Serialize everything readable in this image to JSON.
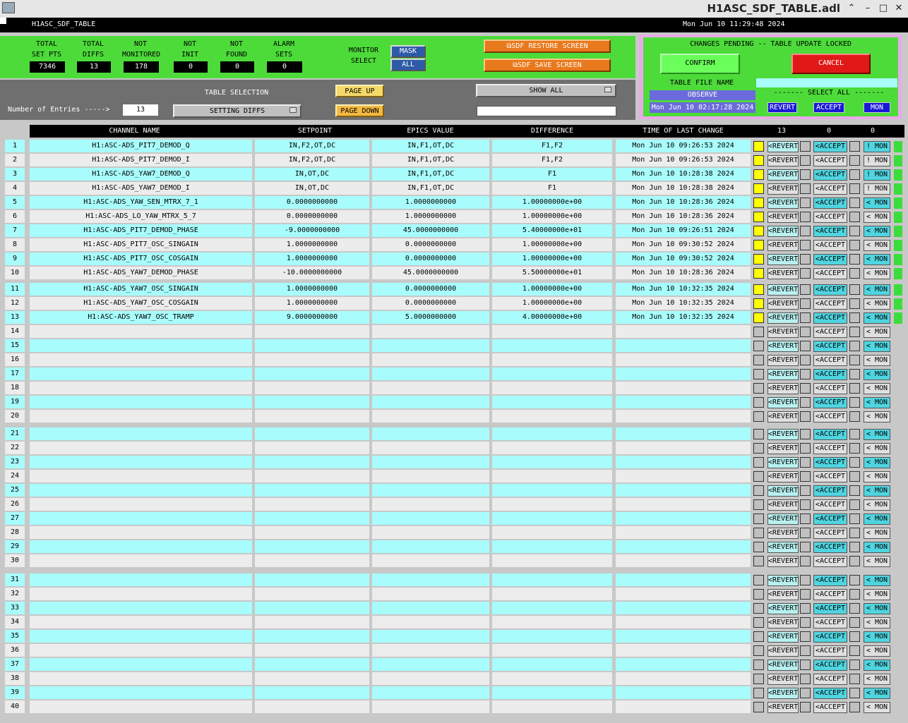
{
  "window": {
    "title": "H1ASC_SDF_TABLE.adl"
  },
  "header": {
    "left": "H1ASC_SDF_TABLE",
    "date": "Mon Jun 10 11:29:48 2024"
  },
  "stats": [
    {
      "label": "TOTAL\nSET PTS",
      "value": "7346"
    },
    {
      "label": "TOTAL\nDIFFS",
      "value": "13"
    },
    {
      "label": "NOT\nMONITORED",
      "value": "178"
    },
    {
      "label": "NOT\nINIT",
      "value": "0"
    },
    {
      "label": "NOT\nFOUND",
      "value": "0"
    },
    {
      "label": "ALARM\nSETS",
      "value": "0"
    }
  ],
  "monitor": {
    "label": "MONITOR\nSELECT",
    "mask": "MASK",
    "all": "ALL"
  },
  "buttons": {
    "restore": "SDF RESTORE SCREEN",
    "save": "SDF SAVE SCREEN",
    "page_up": "PAGE UP",
    "page_down": "PAGE DOWN",
    "show_all": "SHOW ALL"
  },
  "table_selection": {
    "label": "TABLE SELECTION",
    "value": "SETTING DIFFS",
    "entries_label": "Number of Entries ----->",
    "entries": "13"
  },
  "pending": {
    "title": "CHANGES PENDING -- TABLE UPDATE LOCKED",
    "confirm": "CONFIRM",
    "cancel": "CANCEL",
    "file_label": "TABLE FILE NAME",
    "file_value": "OBSERVE",
    "file_date": "Mon Jun 10 02:17:28 2024",
    "select_all": "------- SELECT ALL -------",
    "revert": "REVERT",
    "accept": "ACCEPT",
    "mon": "MON"
  },
  "columns": {
    "name": "CHANNEL NAME",
    "setpoint": "SETPOINT",
    "epics": "EPICS VALUE",
    "diff": "DIFFERENCE",
    "time": "TIME OF LAST CHANGE",
    "count1": "13",
    "count2": "0",
    "count3": "0"
  },
  "row_labels": {
    "revert": "<REVERT",
    "accept": "<ACCEPT",
    "mon_lt": "< MON",
    "mon_bang": "! MON"
  },
  "rows": [
    {
      "n": "1",
      "name": "H1:ASC-ADS_PIT7_DEMOD_Q",
      "set": "IN,F2,OT,DC",
      "epics": "IN,F1,OT,DC",
      "diff": "F1,F2",
      "time": "Mon Jun 10 09:26:53 2024",
      "mon": "! MON"
    },
    {
      "n": "2",
      "name": "H1:ASC-ADS_PIT7_DEMOD_I",
      "set": "IN,F2,OT,DC",
      "epics": "IN,F1,OT,DC",
      "diff": "F1,F2",
      "time": "Mon Jun 10 09:26:53 2024",
      "mon": "! MON"
    },
    {
      "n": "3",
      "name": "H1:ASC-ADS_YAW7_DEMOD_Q",
      "set": "IN,OT,DC",
      "epics": "IN,F1,OT,DC",
      "diff": "F1",
      "time": "Mon Jun 10 10:28:38 2024",
      "mon": "! MON"
    },
    {
      "n": "4",
      "name": "H1:ASC-ADS_YAW7_DEMOD_I",
      "set": "IN,OT,DC",
      "epics": "IN,F1,OT,DC",
      "diff": "F1",
      "time": "Mon Jun 10 10:28:38 2024",
      "mon": "! MON"
    },
    {
      "n": "5",
      "name": "H1:ASC-ADS_YAW_SEN_MTRX_7_1",
      "set": "0.0000000000",
      "epics": "1.0000000000",
      "diff": "1.00000000e+00",
      "time": "Mon Jun 10 10:28:36 2024",
      "mon": "< MON"
    },
    {
      "n": "6",
      "name": "H1:ASC-ADS_LO_YAW_MTRX_5_7",
      "set": "0.0000000000",
      "epics": "1.0000000000",
      "diff": "1.00000000e+00",
      "time": "Mon Jun 10 10:28:36 2024",
      "mon": "< MON"
    },
    {
      "n": "7",
      "name": "H1:ASC-ADS_PIT7_DEMOD_PHASE",
      "set": "-9.0000000000",
      "epics": "45.0000000000",
      "diff": "5.40000000e+01",
      "time": "Mon Jun 10 09:26:51 2024",
      "mon": "< MON"
    },
    {
      "n": "8",
      "name": "H1:ASC-ADS_PIT7_OSC_SINGAIN",
      "set": "1.0000000000",
      "epics": "0.0000000000",
      "diff": "1.00000000e+00",
      "time": "Mon Jun 10 09:30:52 2024",
      "mon": "< MON"
    },
    {
      "n": "9",
      "name": "H1:ASC-ADS_PIT7_OSC_COSGAIN",
      "set": "1.0000000000",
      "epics": "0.0000000000",
      "diff": "1.00000000e+00",
      "time": "Mon Jun 10 09:30:52 2024",
      "mon": "< MON"
    },
    {
      "n": "10",
      "name": "H1:ASC-ADS_YAW7_DEMOD_PHASE",
      "set": "-10.0000000000",
      "epics": "45.0000000000",
      "diff": "5.50000000e+01",
      "time": "Mon Jun 10 10:28:36 2024",
      "mon": "< MON"
    },
    {
      "n": "11",
      "name": "H1:ASC-ADS_YAW7_OSC_SINGAIN",
      "set": "1.0000000000",
      "epics": "0.0000000000",
      "diff": "1.00000000e+00",
      "time": "Mon Jun 10 10:32:35 2024",
      "mon": "< MON"
    },
    {
      "n": "12",
      "name": "H1:ASC-ADS_YAW7_OSC_COSGAIN",
      "set": "1.0000000000",
      "epics": "0.0000000000",
      "diff": "1.00000000e+00",
      "time": "Mon Jun 10 10:32:35 2024",
      "mon": "< MON"
    },
    {
      "n": "13",
      "name": "H1:ASC-ADS_YAW7_OSC_TRAMP",
      "set": "9.0000000000",
      "epics": "5.0000000000",
      "diff": "4.00000000e+00",
      "time": "Mon Jun 10 10:32:35 2024",
      "mon": "< MON"
    },
    {
      "n": "14"
    },
    {
      "n": "15"
    },
    {
      "n": "16"
    },
    {
      "n": "17"
    },
    {
      "n": "18"
    },
    {
      "n": "19"
    },
    {
      "n": "20"
    },
    {
      "n": "21"
    },
    {
      "n": "22"
    },
    {
      "n": "23"
    },
    {
      "n": "24"
    },
    {
      "n": "25"
    },
    {
      "n": "26"
    },
    {
      "n": "27"
    },
    {
      "n": "28"
    },
    {
      "n": "29"
    },
    {
      "n": "30"
    },
    {
      "n": "31"
    },
    {
      "n": "32"
    },
    {
      "n": "33"
    },
    {
      "n": "34"
    },
    {
      "n": "35"
    },
    {
      "n": "36"
    },
    {
      "n": "37"
    },
    {
      "n": "38"
    },
    {
      "n": "39"
    },
    {
      "n": "40"
    }
  ],
  "colors": {
    "cyan_row": "#a8fcfc",
    "gray_row": "#ececec",
    "green_panel": "#4ddb3a"
  }
}
